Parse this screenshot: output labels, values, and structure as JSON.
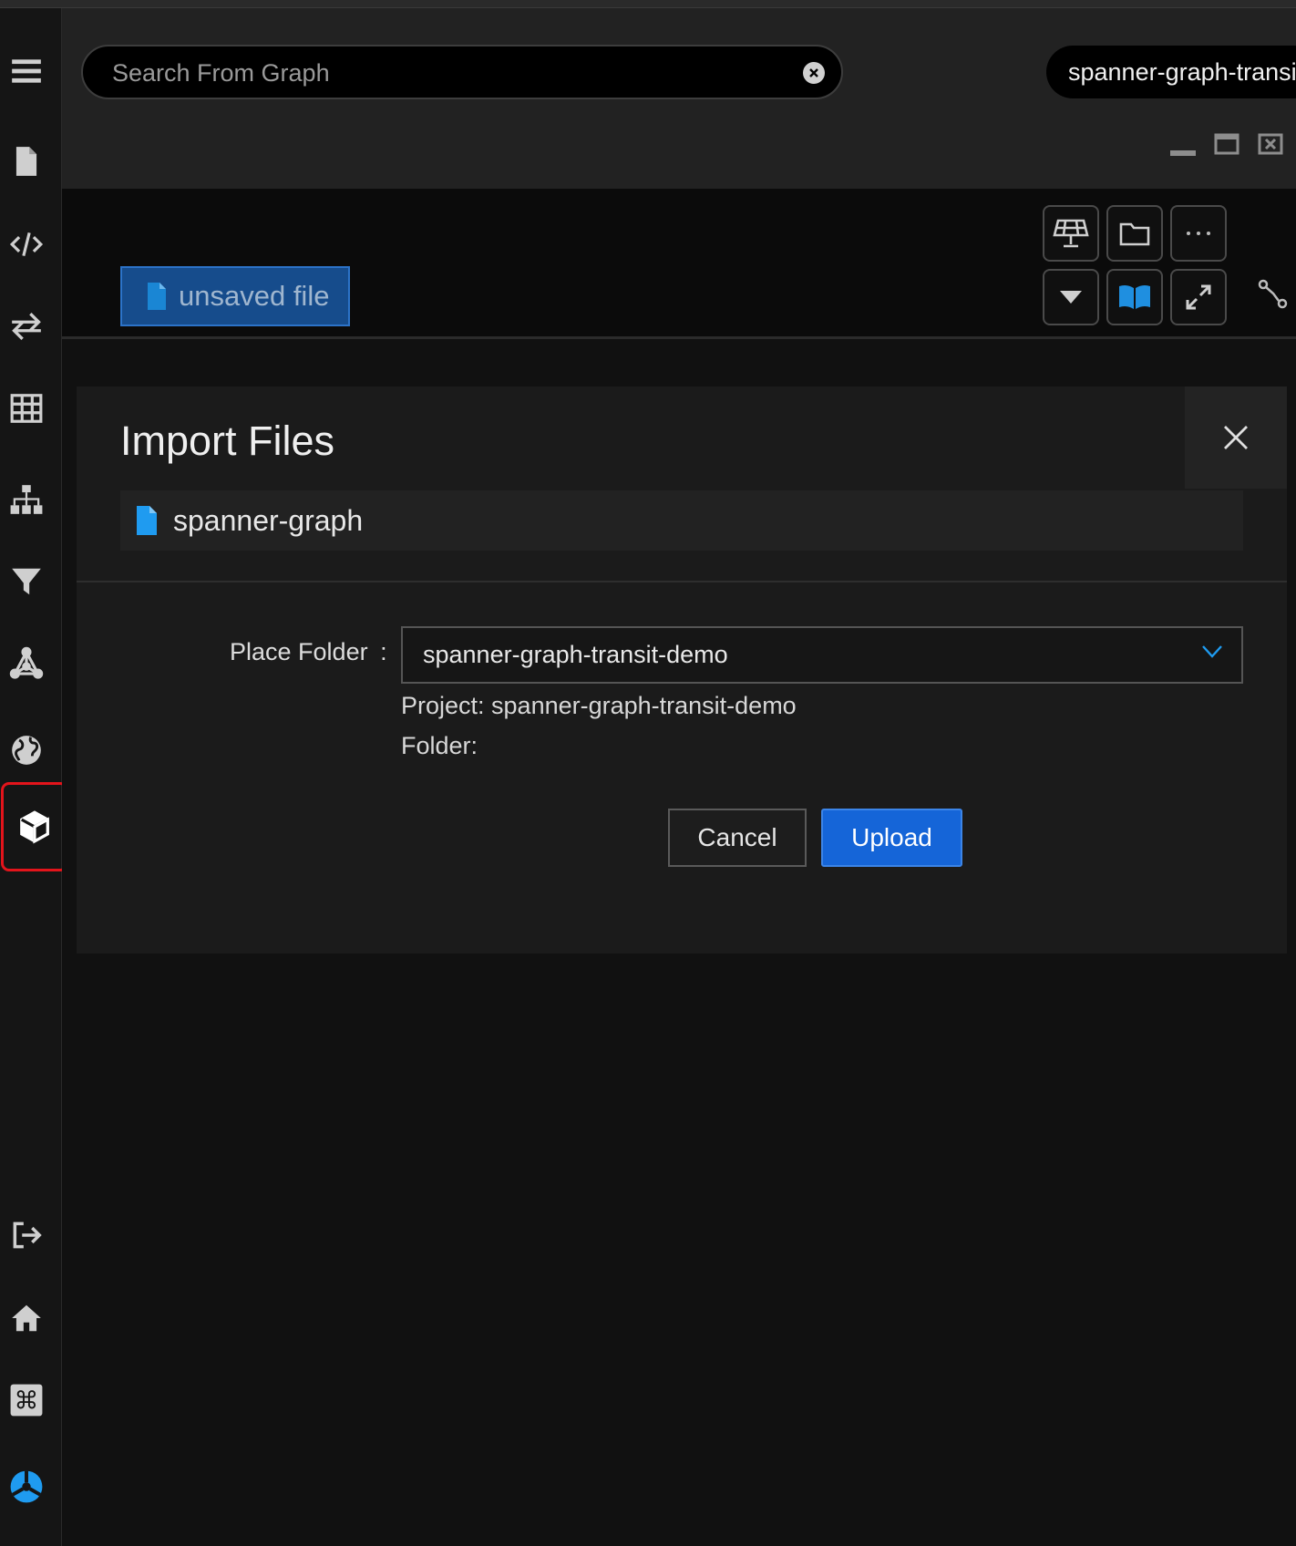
{
  "search": {
    "placeholder": "Search From Graph"
  },
  "project_pill": {
    "label": "spanner-graph-transit-demo"
  },
  "editor": {
    "file_tab_label": "unsaved file"
  },
  "dialog": {
    "title": "Import Files",
    "file_name": "spanner-graph",
    "place_folder_label": "Place Folder",
    "place_folder_colon": ":",
    "place_folder_value": "spanner-graph-transit-demo",
    "project_info": "Project: spanner-graph-transit-demo",
    "folder_info": "Folder:",
    "cancel_label": "Cancel",
    "upload_label": "Upload"
  },
  "colors": {
    "accent_blue": "#1565d8",
    "file_icon_blue": "#1f9bf0",
    "active_highlight": "#e3141b"
  },
  "sidebar_icons": [
    "menu-icon",
    "file-icon",
    "code-icon",
    "transfer-icon",
    "table-icon",
    "hierarchy-icon",
    "filter-icon",
    "graph-network-icon",
    "globe-icon",
    "cube-icon",
    "logout-icon",
    "home-icon",
    "command-icon",
    "logo-icon"
  ]
}
